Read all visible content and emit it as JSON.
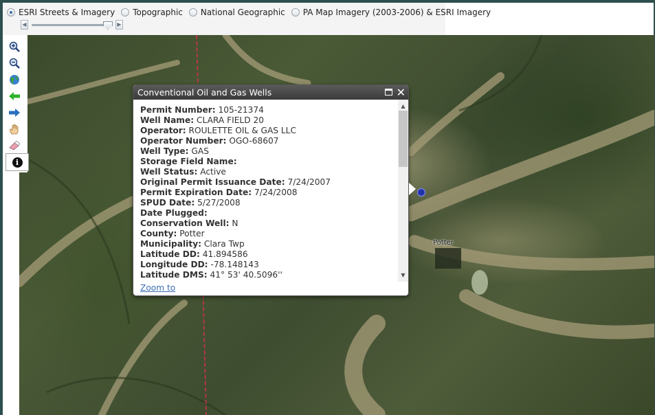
{
  "basemaps": [
    {
      "label": "ESRI Streets & Imagery",
      "checked": true
    },
    {
      "label": "Topographic",
      "checked": false
    },
    {
      "label": "National Geographic",
      "checked": false
    },
    {
      "label": "PA Map Imagery (2003-2006) & ESRI Imagery",
      "checked": false
    }
  ],
  "slider": {
    "prev_glyph": "◀",
    "next_glyph": "▶",
    "value_fraction": 0.88
  },
  "tools": [
    "zoom-in-icon",
    "zoom-out-icon",
    "globe-icon",
    "back-arrow-icon",
    "forward-arrow-icon",
    "pan-hand-icon",
    "eraser-icon",
    "info-icon"
  ],
  "popup": {
    "title": "Conventional Oil and Gas Wells",
    "attributes": [
      {
        "key": "Permit Number:",
        "value": "105-21374"
      },
      {
        "key": "Well Name:",
        "value": "CLARA FIELD 20"
      },
      {
        "key": "Operator:",
        "value": "ROULETTE OIL & GAS LLC"
      },
      {
        "key": "Operator Number:",
        "value": "OGO-68607"
      },
      {
        "key": "Well Type:",
        "value": "GAS"
      },
      {
        "key": "Storage Field Name:",
        "value": ""
      },
      {
        "key": "Well Status:",
        "value": "Active"
      },
      {
        "key": "Original Permit Issuance Date:",
        "value": "7/24/2007"
      },
      {
        "key": "Permit Expiration Date:",
        "value": "7/24/2008"
      },
      {
        "key": "SPUD Date:",
        "value": "5/27/2008"
      },
      {
        "key": "Date Plugged:",
        "value": ""
      },
      {
        "key": "Conservation Well:",
        "value": "N"
      },
      {
        "key": "County:",
        "value": "Potter"
      },
      {
        "key": "Municipality:",
        "value": "Clara Twp"
      },
      {
        "key": "Latitude DD:",
        "value": "41.894586"
      },
      {
        "key": "Longitude DD:",
        "value": "-78.148143"
      },
      {
        "key": "Latitude DMS:",
        "value": "41° 53' 40.5096''"
      }
    ],
    "zoom_link": "Zoom to",
    "info_glyph": "i"
  },
  "map": {
    "county_label": "Potter",
    "marker_color": "#2233aa"
  }
}
